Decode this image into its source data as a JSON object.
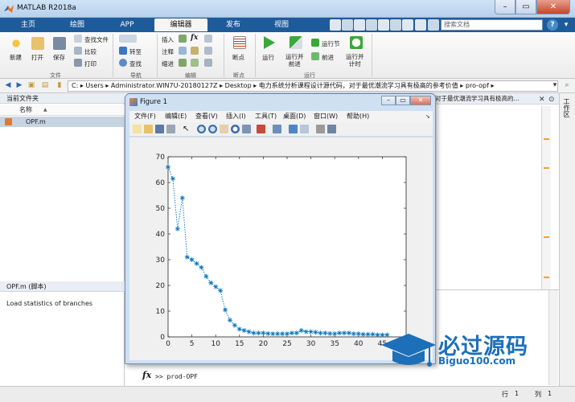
{
  "app": {
    "title": "MATLAB R2018a"
  },
  "tabs": [
    {
      "label": "主页",
      "active": false
    },
    {
      "label": "绘图",
      "active": false
    },
    {
      "label": "APP",
      "active": false
    },
    {
      "label": "编辑器",
      "active": true
    },
    {
      "label": "发布",
      "active": false
    },
    {
      "label": "视图",
      "active": false
    }
  ],
  "search": {
    "placeholder": "搜索文档"
  },
  "ribbon": {
    "file": {
      "group": "文件",
      "new": "新建",
      "open": "打开",
      "save": "保存",
      "find_files": "查找文件",
      "compare": "比较",
      "print": "打印"
    },
    "nav": {
      "group": "导航",
      "goto": "转至",
      "find": "查找"
    },
    "edit": {
      "group": "编辑",
      "insert": "插入",
      "comment": "注释",
      "indent": "缩进",
      "fx": "fx"
    },
    "breakpoints": {
      "group": "断点",
      "breakpoints": "断点"
    },
    "run": {
      "group": "运行",
      "run": "运行",
      "run_advance": "运行并\n前进",
      "run_section": "运行节",
      "advance": "前进",
      "run_time": "运行并\n计时"
    }
  },
  "address": {
    "path": [
      "C:",
      "Users",
      "Administrator.WIN7U-20180127Z",
      "Desktop",
      "电力系统分析课程设计源代码，对于最优潮流学习具有极高的参考价值",
      "pro-opf"
    ]
  },
  "current_folder": {
    "header": "当前文件夹",
    "column": "名称",
    "sort_indicator": "▲",
    "files": [
      "OPF.m"
    ]
  },
  "details": {
    "header": "OPF.m  (脚本)",
    "text": "Load statistics of branches"
  },
  "editor": {
    "tab_text": "对于最优潮流学习具有极高的..."
  },
  "workspace": {
    "label": "工作区"
  },
  "command": {
    "fx": "fx",
    "prompt": ">>",
    "text": "prod-OPF"
  },
  "status": {
    "row_label": "行",
    "row": "1",
    "col_label": "列",
    "col": "1"
  },
  "figure": {
    "title": "Figure 1",
    "menu": [
      "文件(F)",
      "编辑(E)",
      "查看(V)",
      "插入(I)",
      "工具(T)",
      "桌面(D)",
      "窗口(W)",
      "帮助(H)"
    ]
  },
  "chart_data": {
    "type": "line",
    "marker": "*",
    "line_style": "dotted",
    "color": "#0072bd",
    "x": [
      0,
      1,
      2,
      3,
      4,
      5,
      6,
      7,
      8,
      9,
      10,
      11,
      12,
      13,
      14,
      15,
      16,
      17,
      18,
      19,
      20,
      21,
      22,
      23,
      24,
      25,
      26,
      27,
      28,
      29,
      30,
      31,
      32,
      33,
      34,
      35,
      36,
      37,
      38,
      39,
      40,
      41,
      42,
      43,
      44,
      45,
      46
    ],
    "values": [
      66,
      61.5,
      42,
      54,
      31,
      30,
      28.5,
      27,
      23.5,
      21,
      19.5,
      18,
      10.5,
      6.5,
      4.5,
      3,
      2.5,
      2,
      1.5,
      1.5,
      1.5,
      1.3,
      1.2,
      1.2,
      1.2,
      1.2,
      1.5,
      1.5,
      2.5,
      2,
      2,
      1.8,
      1.5,
      1.5,
      1.3,
      1.2,
      1.5,
      1.5,
      1.5,
      1.2,
      1.2,
      1,
      1,
      1,
      0.8,
      0.8,
      0.8
    ],
    "xlim": [
      0,
      50
    ],
    "ylim": [
      0,
      70
    ],
    "xticks": [
      0,
      5,
      10,
      15,
      20,
      25,
      30,
      35,
      40,
      45
    ],
    "yticks": [
      0,
      10,
      20,
      30,
      40,
      50,
      60,
      70
    ],
    "grid": false
  },
  "watermark": {
    "text": "必过源码",
    "subtext": "Biguo100.com"
  },
  "colors": {
    "accent": "#1e5b9a",
    "series": "#0072bd",
    "watermark": "#1d6fb8"
  }
}
